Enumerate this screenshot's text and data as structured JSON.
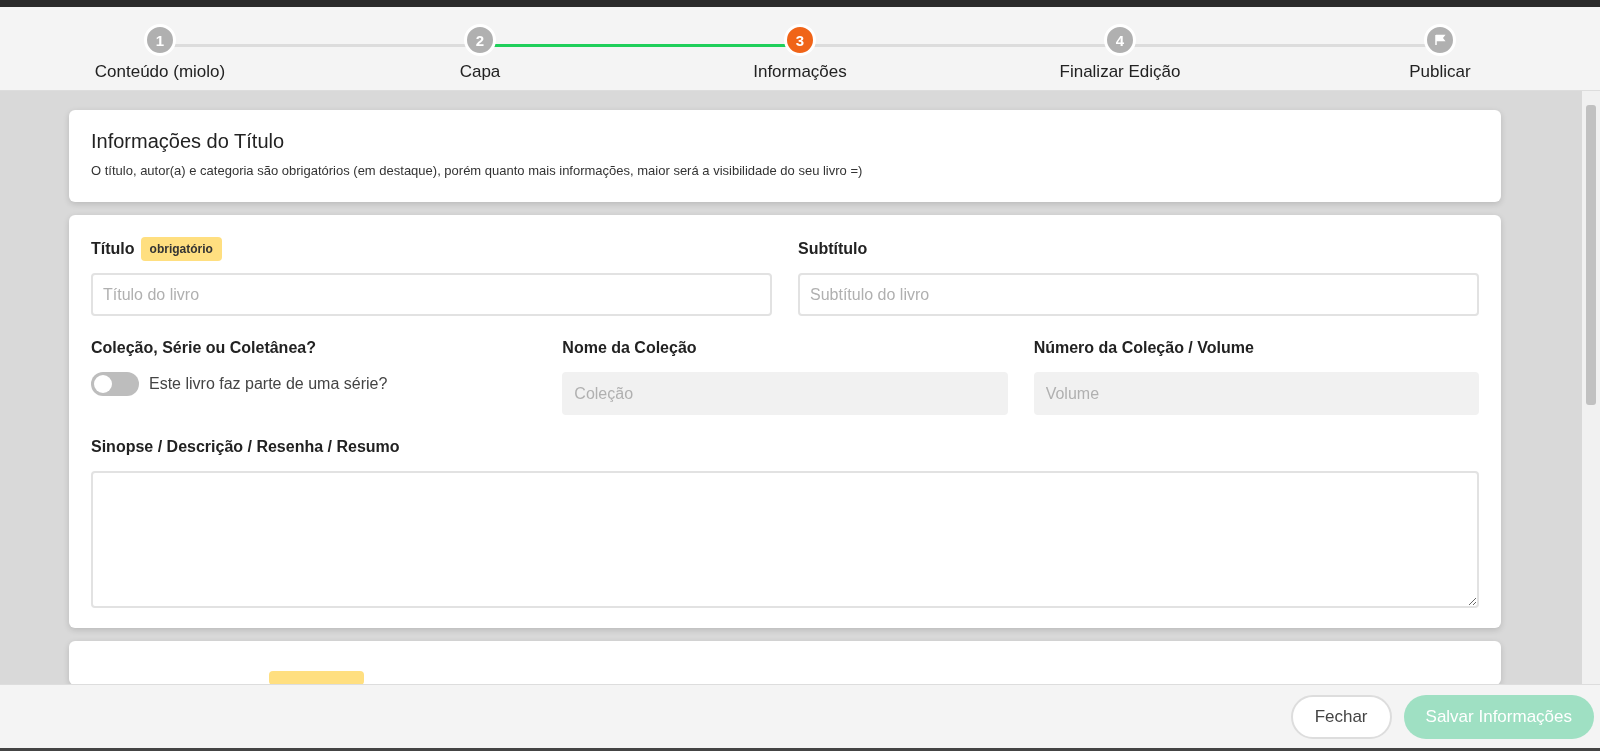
{
  "stepper": {
    "steps": [
      {
        "kind": "number",
        "marker": "1",
        "label": "Conteúdo (miolo)",
        "selected": false
      },
      {
        "kind": "number",
        "marker": "2",
        "label": "Capa",
        "selected": false
      },
      {
        "kind": "number",
        "marker": "3",
        "label": "Informações",
        "selected": true
      },
      {
        "kind": "number",
        "marker": "4",
        "label": "Finalizar Edição",
        "selected": false
      },
      {
        "kind": "flag",
        "label": "Publicar",
        "selected": false
      }
    ]
  },
  "intro_card": {
    "title": "Informações do Título",
    "description": "O título, autor(a) e categoria são obrigatórios (em destaque), porém quanto mais informações, maior será a visibilidade do seu livro =)"
  },
  "form_card": {
    "title_field": {
      "label": "Título",
      "badge": "obrigatório",
      "placeholder": "Título do livro"
    },
    "subtitle_field": {
      "label": "Subtítulo",
      "placeholder": "Subtítulo do livro"
    },
    "series_toggle": {
      "label": "Coleção, Série ou Coletânea?",
      "text": "Este livro faz parte de uma série?",
      "on": false
    },
    "collection_field": {
      "label": "Nome da Coleção",
      "placeholder": "Coleção",
      "disabled": true
    },
    "volume_field": {
      "label": "Número da Coleção / Volume",
      "placeholder": "Volume",
      "disabled": true
    },
    "synopsis_field": {
      "label": "Sinopse / Descrição / Resenha / Resumo"
    }
  },
  "footer": {
    "buttons": [
      {
        "kind": "secondary",
        "label": "Fechar",
        "disabled": false
      },
      {
        "kind": "primary",
        "label": "Salvar Informações",
        "disabled": true
      }
    ]
  }
}
